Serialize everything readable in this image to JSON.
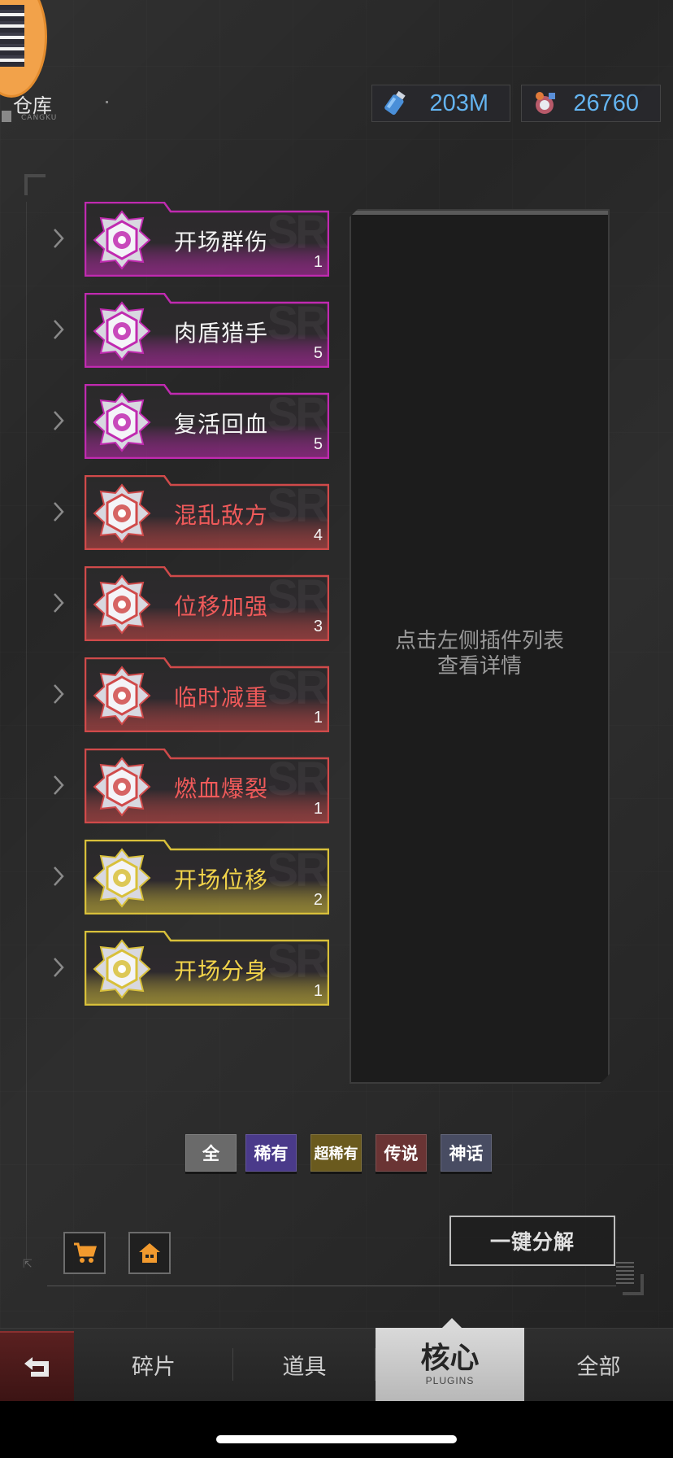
{
  "header": {
    "title": "仓库",
    "subtitle": "CANGKU",
    "currencies": [
      {
        "id": "energy",
        "icon": "energy-bottle-icon",
        "value": "203M"
      },
      {
        "id": "coin",
        "icon": "gear-coin-icon",
        "value": "26760"
      }
    ]
  },
  "plugins": [
    {
      "name": "开场群伤",
      "count": "1",
      "rarity": "legendary",
      "color": "#c02ab0",
      "text_color": "#f2f2f2",
      "icon": "area-damage-icon"
    },
    {
      "name": "肉盾猎手",
      "count": "5",
      "rarity": "legendary",
      "color": "#c02ab0",
      "text_color": "#f2f2f2",
      "icon": "tank-hunter-icon"
    },
    {
      "name": "复活回血",
      "count": "5",
      "rarity": "legendary",
      "color": "#c02ab0",
      "text_color": "#f2f2f2",
      "icon": "revive-heal-icon"
    },
    {
      "name": "混乱敌方",
      "count": "4",
      "rarity": "super-rare",
      "color": "#d04a4a",
      "text_color": "#f05a5a",
      "icon": "confuse-enemy-icon"
    },
    {
      "name": "位移加强",
      "count": "3",
      "rarity": "super-rare",
      "color": "#d04a4a",
      "text_color": "#f05a5a",
      "icon": "dash-boost-icon"
    },
    {
      "name": "临时减重",
      "count": "1",
      "rarity": "super-rare",
      "color": "#d04a4a",
      "text_color": "#f05a5a",
      "icon": "weight-reduce-icon"
    },
    {
      "name": "燃血爆裂",
      "count": "1",
      "rarity": "super-rare",
      "color": "#d04a4a",
      "text_color": "#f05a5a",
      "icon": "blood-burst-icon"
    },
    {
      "name": "开场位移",
      "count": "2",
      "rarity": "rare",
      "color": "#d8c03a",
      "text_color": "#f2d44a",
      "icon": "opening-dash-icon"
    },
    {
      "name": "开场分身",
      "count": "1",
      "rarity": "rare",
      "color": "#d8c03a",
      "text_color": "#f2d44a",
      "icon": "clone-icon"
    }
  ],
  "detail": {
    "hint": "点击左侧插件列表\n查看详情"
  },
  "filters": [
    {
      "label": "全",
      "bg": "#6a6a6a"
    },
    {
      "label": "稀有",
      "bg": "#4a3a8a"
    },
    {
      "label": "超稀有",
      "bg": "#6a5a1e"
    },
    {
      "label": "传说",
      "bg": "#6a3434"
    },
    {
      "label": "神话",
      "bg": "#484c62"
    }
  ],
  "actions": {
    "decompose_label": "一键分解",
    "shop_icon": "cart-icon",
    "home_icon": "house-icon"
  },
  "tabs": [
    {
      "label": "碎片",
      "active": false
    },
    {
      "label": "道具",
      "active": false
    },
    {
      "label": "核心",
      "sub": "PLUGINS",
      "active": true
    },
    {
      "label": "全部",
      "active": false
    }
  ]
}
